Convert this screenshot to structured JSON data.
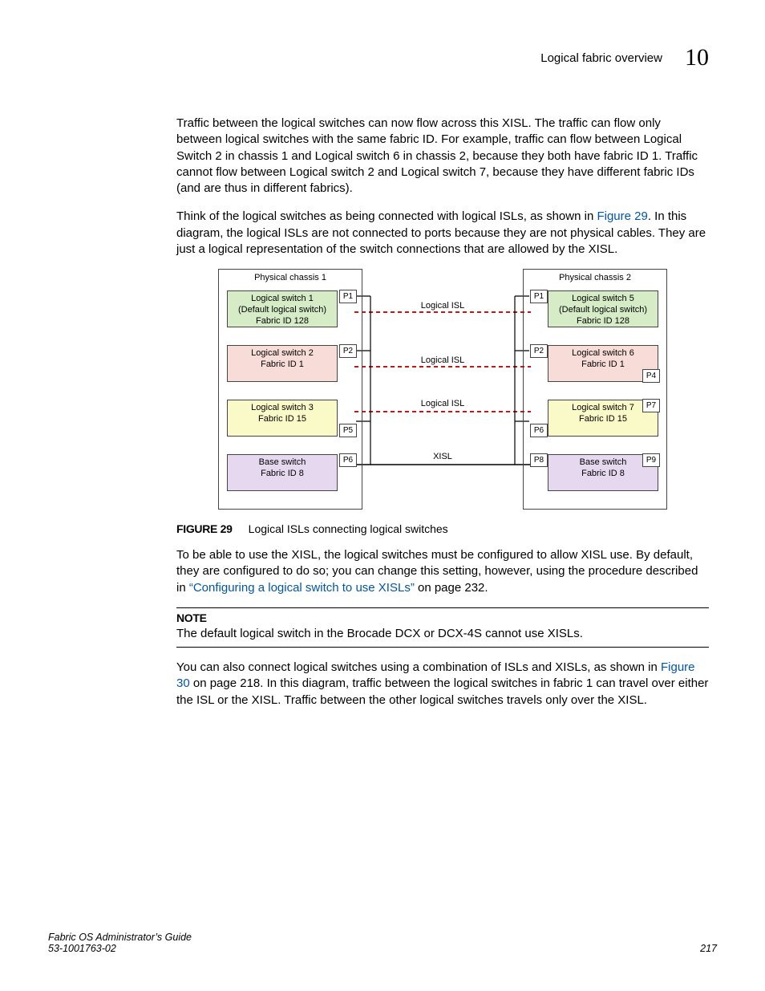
{
  "header": {
    "title": "Logical fabric overview",
    "chapter": "10"
  },
  "paragraphs": {
    "p1": "Traffic between the logical switches can now flow across this XISL. The traffic can flow only between logical switches with the same fabric ID. For example, traffic can flow between Logical Switch 2 in chassis 1 and Logical switch 6 in chassis 2, because they both have fabric ID 1. Traffic cannot flow between Logical switch 2 and Logical switch 7, because they have different fabric IDs (and are thus in different fabrics).",
    "p2a": "Think of the logical switches as being connected with logical ISLs, as shown in ",
    "p2link": "Figure 29",
    "p2b": ". In this diagram, the logical ISLs are not connected to ports because they are not physical cables. They are just a logical representation of the switch connections that are allowed by the XISL.",
    "p3a": "To be able to use the XISL, the logical switches must be configured to allow XISL use. By default, they are configured to do so; you can change this setting, however, using the procedure described in ",
    "p3link": "“Configuring a logical switch to use XISLs”",
    "p3b": " on page 232.",
    "p4a": "You can also connect logical switches using a combination of ISLs and XISLs, as shown in ",
    "p4link": "Figure 30",
    "p4b": " on page 218. In this diagram, traffic between the logical switches in fabric 1 can travel over either the ISL or the XISL. Traffic between the other logical switches travels only over the XISL."
  },
  "figure": {
    "label": "FIGURE 29",
    "caption": "Logical ISLs connecting logical switches"
  },
  "note": {
    "label": "NOTE",
    "text": "The default logical switch in the Brocade DCX or DCX-4S cannot use XISLs."
  },
  "diagram": {
    "chassis1": "Physical chassis 1",
    "chassis2": "Physical chassis 2",
    "left": {
      "s1": {
        "l1": "Logical switch 1",
        "l2": "(Default logical switch)",
        "l3": "Fabric ID 128"
      },
      "s2": {
        "l1": "Logical switch 2",
        "l3": "Fabric ID 1"
      },
      "s3": {
        "l1": "Logical switch 3",
        "l3": "Fabric ID 15"
      },
      "s4": {
        "l1": "Base switch",
        "l3": "Fabric ID 8"
      }
    },
    "right": {
      "s1": {
        "l1": "Logical switch 5",
        "l2": "(Default logical switch)",
        "l3": "Fabric ID 128"
      },
      "s2": {
        "l1": "Logical switch 6",
        "l3": "Fabric ID 1"
      },
      "s3": {
        "l1": "Logical switch 7",
        "l3": "Fabric ID 15"
      },
      "s4": {
        "l1": "Base switch",
        "l3": "Fabric ID 8"
      }
    },
    "ports": {
      "p1": "P1",
      "p2": "P2",
      "p4": "P4",
      "p5": "P5",
      "p6": "P6",
      "p7": "P7",
      "p8": "P8",
      "p9": "P9"
    },
    "labels": {
      "lisl": "Logical ISL",
      "xisl": "XISL"
    }
  },
  "footer": {
    "l1": "Fabric OS Administrator’s Guide",
    "l2": "53-1001763-02",
    "page": "217"
  }
}
